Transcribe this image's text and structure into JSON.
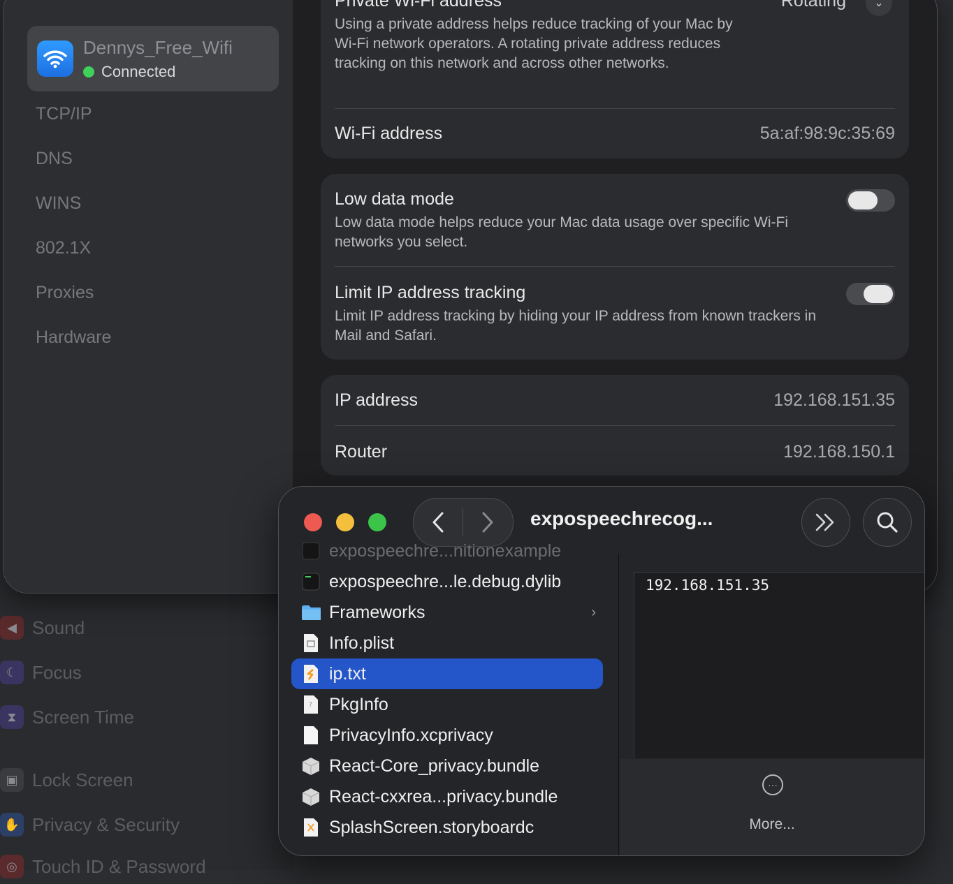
{
  "background_sidebar": {
    "items": [
      {
        "label": "Sound",
        "icon": "speaker-icon"
      },
      {
        "label": "Focus",
        "icon": "moon-icon"
      },
      {
        "label": "Screen Time",
        "icon": "hourglass-icon"
      },
      {
        "label": "Lock Screen",
        "icon": "lock-icon"
      },
      {
        "label": "Privacy & Security",
        "icon": "hand-icon"
      },
      {
        "label": "Touch ID & Password",
        "icon": "fingerprint-icon"
      }
    ]
  },
  "network_sheet": {
    "network_name": "Dennys_Free_Wifi",
    "status": "Connected",
    "tabs": [
      "TCP/IP",
      "DNS",
      "WINS",
      "802.1X",
      "Proxies",
      "Hardware"
    ],
    "private_address": {
      "title": "Private Wi-Fi address",
      "value": "Rotating",
      "description": "Using a private address helps reduce tracking of your Mac by Wi-Fi network operators. A rotating private address reduces tracking on this network and across other networks."
    },
    "wifi_address": {
      "label": "Wi-Fi address",
      "value": "5a:af:98:9c:35:69"
    },
    "low_data_mode": {
      "title": "Low data mode",
      "description": "Low data mode helps reduce your Mac data usage over specific Wi-Fi networks you select.",
      "enabled": false
    },
    "limit_ip_tracking": {
      "title": "Limit IP address tracking",
      "description": "Limit IP address tracking by hiding your IP address from known trackers in Mail and Safari.",
      "enabled": true
    },
    "ip_address": {
      "label": "IP address",
      "value": "192.168.151.35"
    },
    "router": {
      "label": "Router",
      "value": "192.168.150.1"
    }
  },
  "finder": {
    "title": "expospeechrecog...",
    "files": [
      {
        "name": "expospeechre...nitionexample",
        "icon": "exec-icon"
      },
      {
        "name": "expospeechre...le.debug.dylib",
        "icon": "exec-icon"
      },
      {
        "name": "Frameworks",
        "icon": "folder-icon"
      },
      {
        "name": "Info.plist",
        "icon": "plist-icon"
      },
      {
        "name": "ip.txt",
        "icon": "text-file-icon"
      },
      {
        "name": "PkgInfo",
        "icon": "generic-file-icon"
      },
      {
        "name": "PrivacyInfo.xcprivacy",
        "icon": "document-icon"
      },
      {
        "name": "React-Core_privacy.bundle",
        "icon": "bundle-icon"
      },
      {
        "name": "React-cxxrea...privacy.bundle",
        "icon": "bundle-icon"
      },
      {
        "name": "SplashScreen.storyboardc",
        "icon": "storyboard-icon"
      }
    ],
    "selected_file": "ip.txt",
    "preview_text": "192.168.151.35",
    "more_label": "More..."
  },
  "colors": {
    "accent_blue": "#2456c9",
    "connected_green": "#3fd25b",
    "close_red": "#ee5a52",
    "minimize_yellow": "#f4bf3d",
    "zoom_green": "#3cc34a"
  }
}
